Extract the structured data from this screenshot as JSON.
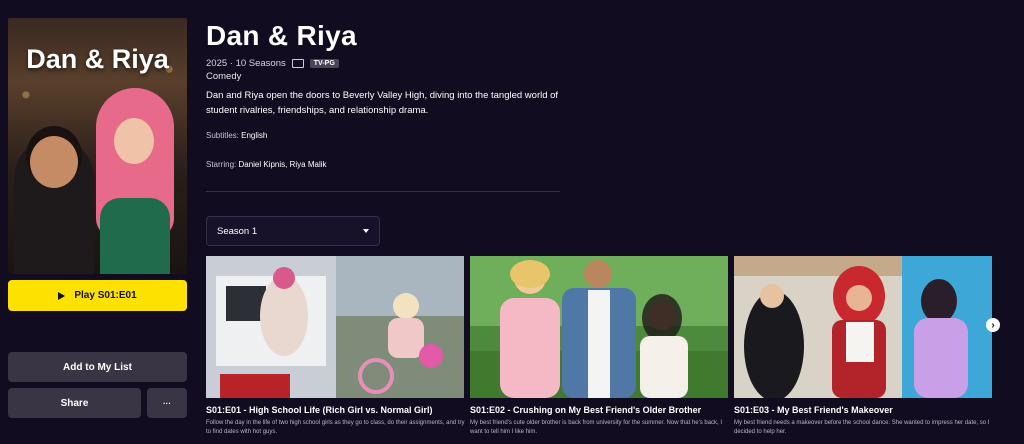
{
  "show": {
    "title": "Dan & Riya",
    "poster_title": "Dan & Riya",
    "year_seasons": "2025 · 10 Seasons",
    "rating": "TV-PG",
    "genre": "Comedy",
    "description": "Dan and Riya open the doors to Beverly Valley High, diving into the tangled world of student rivalries, friendships, and relationship drama.",
    "subtitles_label": "Subtitles: ",
    "subtitles_value": "English",
    "starring_label": "Starring: ",
    "starring_value": "Daniel Kipnis, Riya Malik"
  },
  "actions": {
    "play_label": "Play S01:E01",
    "add_list_label": "Add to My List",
    "share_label": "Share",
    "more_label": "···"
  },
  "season_select": {
    "selected": "Season 1"
  },
  "episodes": [
    {
      "title": "S01:E01 - High School Life (Rich Girl vs. Normal Girl)",
      "description": "Follow the day in the life of two high school girls as they go to class, do their assignments, and try to find dates with hot guys."
    },
    {
      "title": "S01:E02 - Crushing on My Best Friend's Older Brother",
      "description": "My best friend's cute older brother is back from university for the summer. Now that he's back, I want to tell him I like him."
    },
    {
      "title": "S01:E03 - My Best Friend's Makeover",
      "description": "My best friend needs a makeover before the school dance. She wanted to impress her date, so I decided to help her."
    }
  ],
  "colors": {
    "background": "#120c20",
    "play_button": "#fde100",
    "secondary_button": "#3a3545"
  },
  "icons": {
    "play": "play-icon",
    "subtitles": "closed-captions-icon",
    "dropdown": "chevron-down-icon",
    "next": "chevron-right-icon"
  }
}
